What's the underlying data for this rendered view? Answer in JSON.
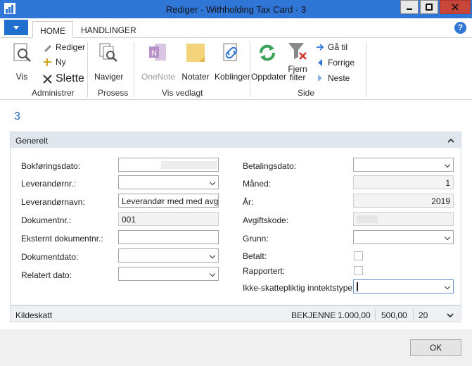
{
  "window": {
    "title": "Rediger - Withholding Tax Card - 3"
  },
  "ribbon": {
    "tabs": [
      "HOME",
      "HANDLINGER"
    ],
    "help": "?",
    "groups": {
      "administrer": "Administrer",
      "prosess": "Prosess",
      "vis_vedlagt": "Vis vedlagt",
      "side": "Side"
    },
    "buttons": {
      "vis": "Vis",
      "rediger": "Rediger",
      "ny": "Ny",
      "slette": "Slette",
      "naviger": "Naviger",
      "onenote": "OneNote",
      "notater": "Notater",
      "koblinger": "Koblinger",
      "oppdater": "Oppdater",
      "fjern_filter_1": "Fjern",
      "fjern_filter_2": "filter",
      "ga_til": "Gå til",
      "forrige": "Forrige",
      "neste": "Neste"
    }
  },
  "page": {
    "record_no": "3"
  },
  "general": {
    "title": "Generelt",
    "left_fields": [
      {
        "label": "Bokføringsdato:",
        "value": ""
      },
      {
        "label": "Leverandørnr.:",
        "value": ""
      },
      {
        "label": "Leverandørnavn:",
        "value": "Leverandør med med avgift"
      },
      {
        "label": "Dokumentnr.:",
        "value": "001"
      },
      {
        "label": "Eksternt dokumentnr.:",
        "value": ""
      },
      {
        "label": "Dokumentdato:",
        "value": ""
      },
      {
        "label": "Relatert dato:",
        "value": ""
      }
    ],
    "right_fields": [
      {
        "label": "Betalingsdato:",
        "value": ""
      },
      {
        "label": "Måned:",
        "value": "1"
      },
      {
        "label": "År:",
        "value": "2019"
      },
      {
        "label": "Avgiftskode:",
        "value": ""
      },
      {
        "label": "Grunn:",
        "value": ""
      },
      {
        "label": "Betalt:",
        "checked": false
      },
      {
        "label": "Rapportert:",
        "checked": false
      },
      {
        "label": "Ikke-skattepliktig inntektstype:",
        "value": ""
      }
    ]
  },
  "kildeskatt": {
    "title": "Kildeskatt",
    "summary": [
      "BEKJENNE",
      "1.000,00",
      "500,00",
      "20"
    ]
  },
  "footer": {
    "ok": "OK"
  },
  "colors": {
    "titlebar": "#2f76d6",
    "close": "#c8453a",
    "accent": "#2a6ebb"
  }
}
